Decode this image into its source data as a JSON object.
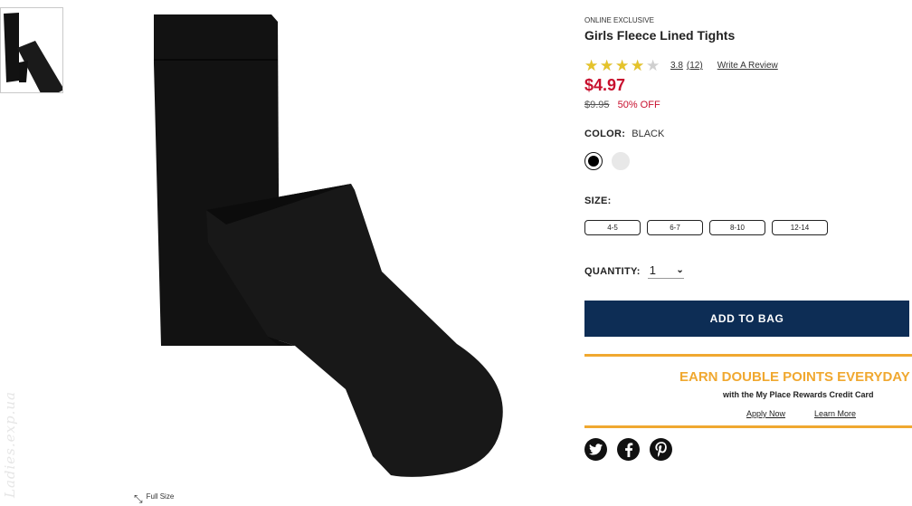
{
  "product": {
    "eyebrow": "ONLINE EXCLUSIVE",
    "title": "Girls Fleece Lined Tights",
    "rating": {
      "value": 3.8,
      "value_text": "3.8",
      "count_text": "(12)",
      "write_review": "Write A Review"
    },
    "price": "$4.97",
    "original_price": "$9.95",
    "discount": "50% OFF",
    "color_label": "COLOR:",
    "color_value": "BLACK",
    "swatches": [
      {
        "name": "black",
        "color": "#000000",
        "selected": true
      },
      {
        "name": "white",
        "color": "#e8e8e8",
        "selected": false
      }
    ],
    "size_label": "SIZE:",
    "sizes": [
      "4-5",
      "6-7",
      "8-10",
      "12-14"
    ],
    "quantity_label": "QUANTITY:",
    "quantity_value": "1",
    "add_to_bag": "ADD TO BAG"
  },
  "promo": {
    "headline": "EARN DOUBLE POINTS EVERYDAY",
    "subline": "with the My Place Rewards Credit Card",
    "apply_link": "Apply Now",
    "learn_link": "Learn More",
    "accent": "#f0a830"
  },
  "gallery": {
    "full_size_label": "Full Size"
  },
  "watermark": "Ladies.exp.ua",
  "social": [
    "twitter-icon",
    "facebook-icon",
    "pinterest-icon"
  ],
  "colors": {
    "button": "#0d2d55",
    "price": "#c8102e",
    "star": "#e5c32a"
  }
}
